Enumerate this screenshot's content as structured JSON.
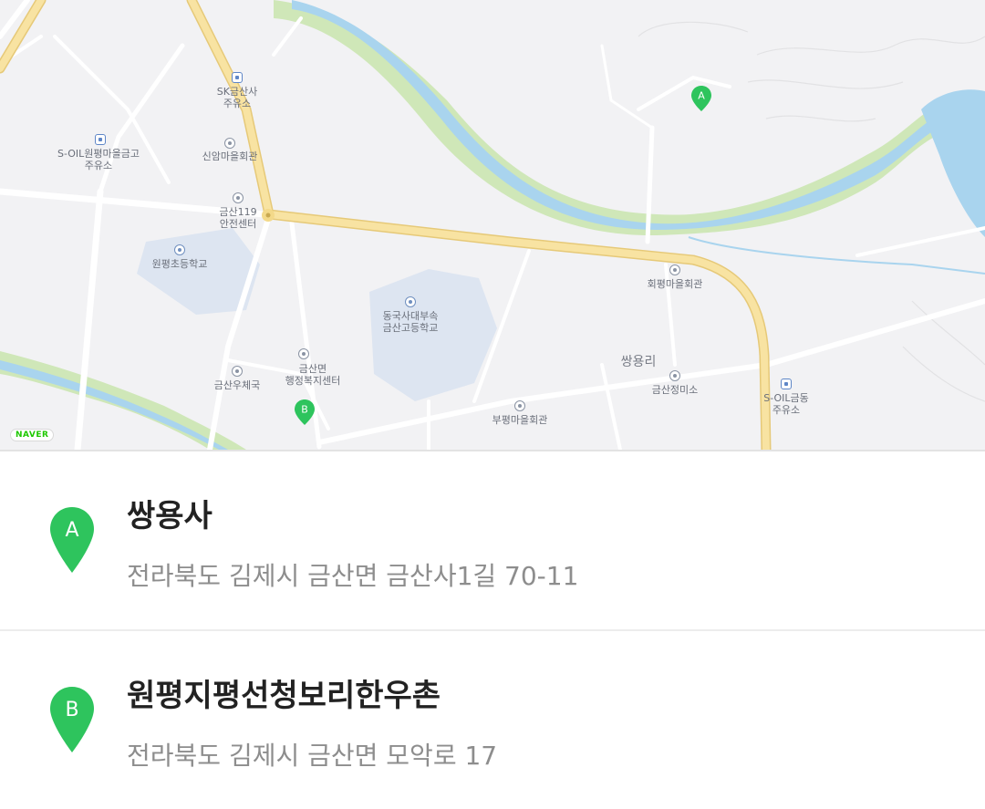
{
  "map": {
    "badge": "NAVER",
    "labels": {
      "sk_gas": "SK금산사\n주유소",
      "soil_gas1": "S-OIL원평마을금고\n주유소",
      "sinam": "신암마을회관",
      "fire": "금산119\n안전센터",
      "wonpyeong_school": "원평초등학교",
      "dongguk": "동국사대부속\n금산고등학교",
      "hoepyeong": "회평마을회관",
      "ssangyongri": "쌍용리",
      "geumsan_office": "금산면\n행정복지센터",
      "post": "금산우체국",
      "jeongmiso": "금산정미소",
      "bupyeong": "부평마을회관",
      "soil_gas2": "S-OIL금동\n주유소"
    },
    "pin_a": "A",
    "pin_b": "B"
  },
  "places": [
    {
      "marker": "A",
      "name": "쌍용사",
      "address": "전라북도 김제시 금산면 금산사1길 70-11"
    },
    {
      "marker": "B",
      "name": "원평지평선청보리한우촌",
      "address": "전라북도 김제시 금산면 모악로 17"
    }
  ],
  "colors": {
    "pin_green": "#2ec45d",
    "road_yellow": "#f6dc8e",
    "river": "#9fd0ec",
    "river_bank": "#cbe6b3"
  }
}
